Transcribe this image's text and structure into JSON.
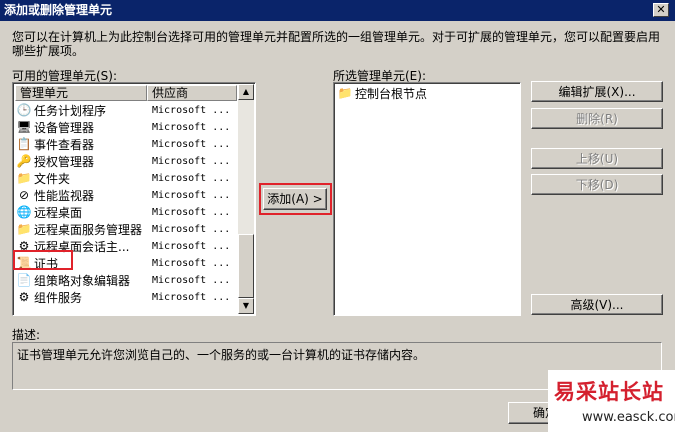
{
  "window": {
    "title": "添加或删除管理单元",
    "close_glyph": "✕"
  },
  "intro": "您可以在计算机上为此控制台选择可用的管理单元并配置所选的一组管理单元。对于可扩展的管理单元，您可以配置要启用哪些扩展项。",
  "available": {
    "label": "可用的管理单元(S):",
    "col_name": "管理单元",
    "col_vendor": "供应商",
    "items": [
      {
        "name": "任务计划程序",
        "vendor": "Microsoft ...",
        "icon": "clock-icon",
        "glyph": "🕒"
      },
      {
        "name": "设备管理器",
        "vendor": "Microsoft ...",
        "icon": "device-manager-icon",
        "glyph": "🖥"
      },
      {
        "name": "事件查看器",
        "vendor": "Microsoft ...",
        "icon": "event-viewer-icon",
        "glyph": "📋"
      },
      {
        "name": "授权管理器",
        "vendor": "Microsoft ...",
        "icon": "authorization-icon",
        "glyph": "🔑"
      },
      {
        "name": "文件夹",
        "vendor": "Microsoft ...",
        "icon": "folder-icon",
        "glyph": "📁"
      },
      {
        "name": "性能监视器",
        "vendor": "Microsoft ...",
        "icon": "performance-icon",
        "glyph": "⊘"
      },
      {
        "name": "远程桌面",
        "vendor": "Microsoft ...",
        "icon": "remote-desktop-icon",
        "glyph": "🌐"
      },
      {
        "name": "远程桌面服务管理器",
        "vendor": "Microsoft ...",
        "icon": "folder-icon",
        "glyph": "📁"
      },
      {
        "name": "远程桌面会话主...",
        "vendor": "Microsoft ...",
        "icon": "session-host-icon",
        "glyph": "⚙"
      },
      {
        "name": "证书",
        "vendor": "Microsoft ...",
        "icon": "certificate-icon",
        "glyph": "📜"
      },
      {
        "name": "组策略对象编辑器",
        "vendor": "Microsoft ...",
        "icon": "group-policy-icon",
        "glyph": "📄"
      },
      {
        "name": "组件服务",
        "vendor": "Microsoft ...",
        "icon": "component-services-icon",
        "glyph": "⚙"
      }
    ]
  },
  "add_button": "添加(A) >",
  "selected": {
    "label": "所选管理单元(E):",
    "items": [
      {
        "name": "控制台根节点",
        "icon": "folder-icon",
        "glyph": "📁"
      }
    ]
  },
  "buttons": {
    "edit_extensions": "编辑扩展(X)...",
    "remove": "删除(R)",
    "move_up": "上移(U)",
    "move_down": "下移(D)",
    "advanced": "高级(V)...",
    "ok": "确定"
  },
  "description": {
    "label": "描述:",
    "text": "证书管理单元允许您浏览自己的、一个服务的或一台计算机的证书存储内容。"
  },
  "watermark": {
    "title": "易采站长站",
    "url": "www.easck.com"
  },
  "colors": {
    "titlebar": "#0a246a",
    "highlight_box": "#e0222a",
    "dialog_bg": "#d4d0c8"
  }
}
